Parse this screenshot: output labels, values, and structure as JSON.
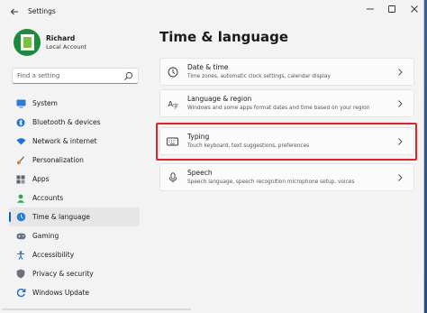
{
  "window": {
    "title": "Settings"
  },
  "user": {
    "name": "Richard",
    "account_type": "Local Account"
  },
  "search": {
    "placeholder": "Find a setting"
  },
  "nav": {
    "items": [
      {
        "label": "System",
        "icon": "monitor-icon",
        "color": "#2b7cd3"
      },
      {
        "label": "Bluetooth & devices",
        "icon": "bluetooth-icon",
        "color": "#1d6fd1"
      },
      {
        "label": "Network & internet",
        "icon": "wifi-icon",
        "color": "#1d6fd1"
      },
      {
        "label": "Personalization",
        "icon": "brush-icon",
        "color": "#e07b2b"
      },
      {
        "label": "Apps",
        "icon": "apps-icon",
        "color": "#5a6570"
      },
      {
        "label": "Accounts",
        "icon": "account-icon",
        "color": "#2fa35a"
      },
      {
        "label": "Time & language",
        "icon": "globe-clock-icon",
        "color": "#2b7cd3",
        "active": true
      },
      {
        "label": "Gaming",
        "icon": "gamepad-icon",
        "color": "#6b7280"
      },
      {
        "label": "Accessibility",
        "icon": "accessibility-icon",
        "color": "#1d6fd1"
      },
      {
        "label": "Privacy & security",
        "icon": "shield-icon",
        "color": "#6b7280"
      },
      {
        "label": "Windows Update",
        "icon": "update-icon",
        "color": "#1d6fd1"
      }
    ]
  },
  "main": {
    "title": "Time & language",
    "cards": [
      {
        "title": "Date & time",
        "description": "Time zones, automatic clock settings, calendar display",
        "icon": "clock-icon"
      },
      {
        "title": "Language & region",
        "description": "Windows and some apps format dates and time based on your region",
        "icon": "language-icon"
      },
      {
        "title": "Typing",
        "description": "Touch keyboard, text suggestions, preferences",
        "icon": "keyboard-icon",
        "highlighted": true
      },
      {
        "title": "Speech",
        "description": "Speech language, speech recognition microphone setup, voices",
        "icon": "microphone-icon"
      }
    ]
  },
  "colors": {
    "accent": "#0067c0",
    "highlight": "#d9262a"
  }
}
